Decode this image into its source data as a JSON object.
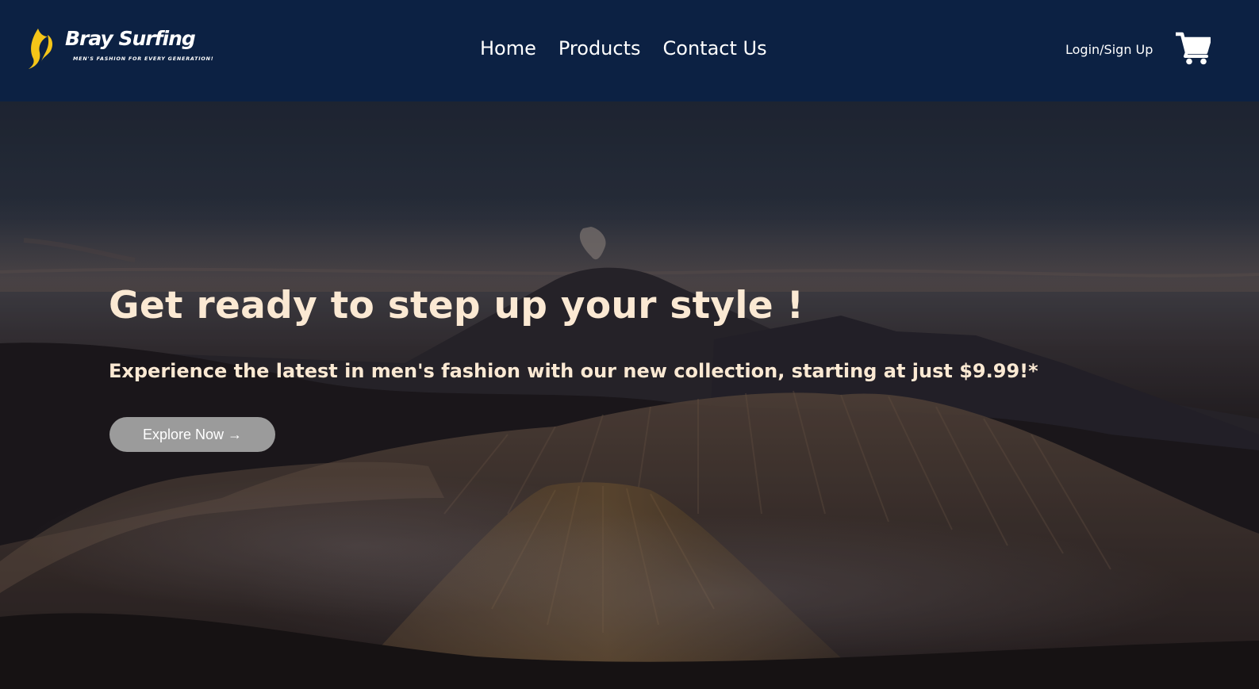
{
  "brand": {
    "name": "Bray Surfing",
    "tagline": "MEN'S FASHION FOR EVERY GENERATION!",
    "accent_color": "#f5c518",
    "logo_icon": "leaf-wave-icon"
  },
  "nav": {
    "links": [
      {
        "label": "Home"
      },
      {
        "label": "Products"
      },
      {
        "label": "Contact Us"
      }
    ],
    "login_label": "Login/Sign Up",
    "cart_icon": "shopping-cart-icon",
    "background_color": "#0c2143"
  },
  "hero": {
    "title": "Get ready to step up your style !",
    "subtitle": "Experience the latest in men's fashion with our new collection, starting at just $9.99!*",
    "cta_label": "Explore Now →",
    "background_image": "volcanic-mountain-landscape-at-dusk",
    "text_color": "#fbe9d3",
    "cta_color": "#9b9b9b"
  }
}
